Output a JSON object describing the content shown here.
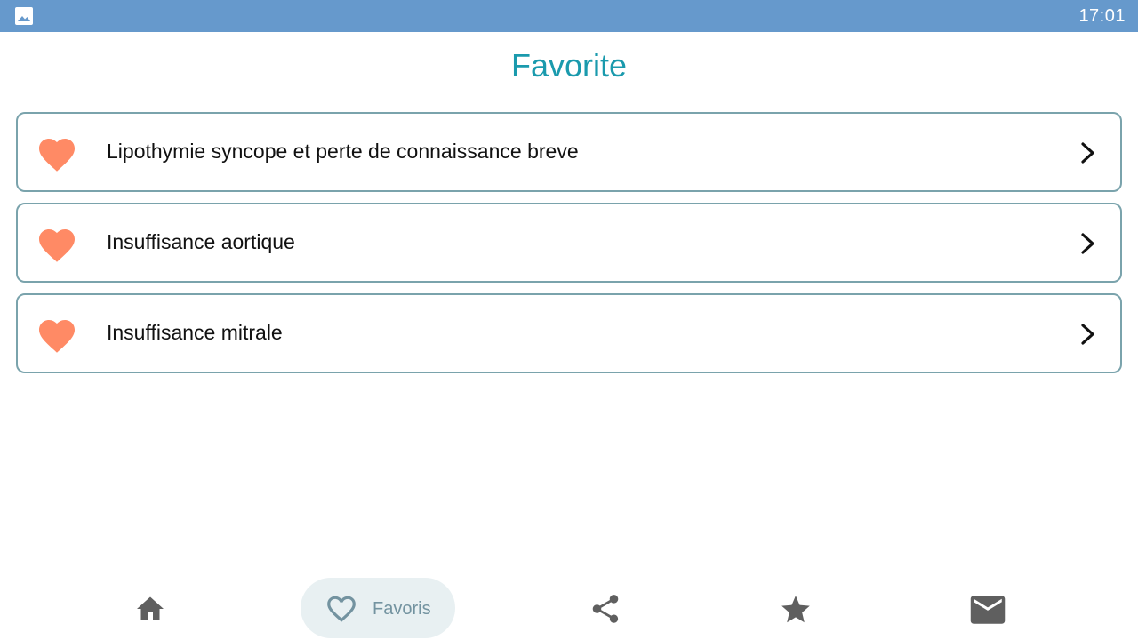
{
  "status_bar": {
    "time": "17:01",
    "left_icon": "image-icon"
  },
  "page": {
    "title": "Favorite"
  },
  "favorites": [
    {
      "label": "Lipothymie syncope et perte de connaissance breve",
      "icon": "heart-icon"
    },
    {
      "label": "Insuffisance aortique",
      "icon": "heart-icon"
    },
    {
      "label": "Insuffisance mitrale",
      "icon": "heart-icon"
    }
  ],
  "bottom_nav": {
    "items": [
      {
        "id": "home",
        "icon": "home-icon",
        "active": false
      },
      {
        "id": "favoris",
        "icon": "heart-outline-icon",
        "label": "Favoris",
        "active": true
      },
      {
        "id": "share",
        "icon": "share-icon",
        "active": false
      },
      {
        "id": "rate",
        "icon": "star-icon",
        "active": false
      },
      {
        "id": "contact",
        "icon": "mail-icon",
        "active": false
      }
    ]
  },
  "colors": {
    "status_bar": "#6699cc",
    "title": "#1a9aad",
    "heart": "#ff8a65",
    "card_border": "#7aa3ac",
    "nav_icon": "#5f5f5f",
    "nav_active_bg": "#e8f0f2",
    "nav_active_fg": "#7393a0"
  }
}
